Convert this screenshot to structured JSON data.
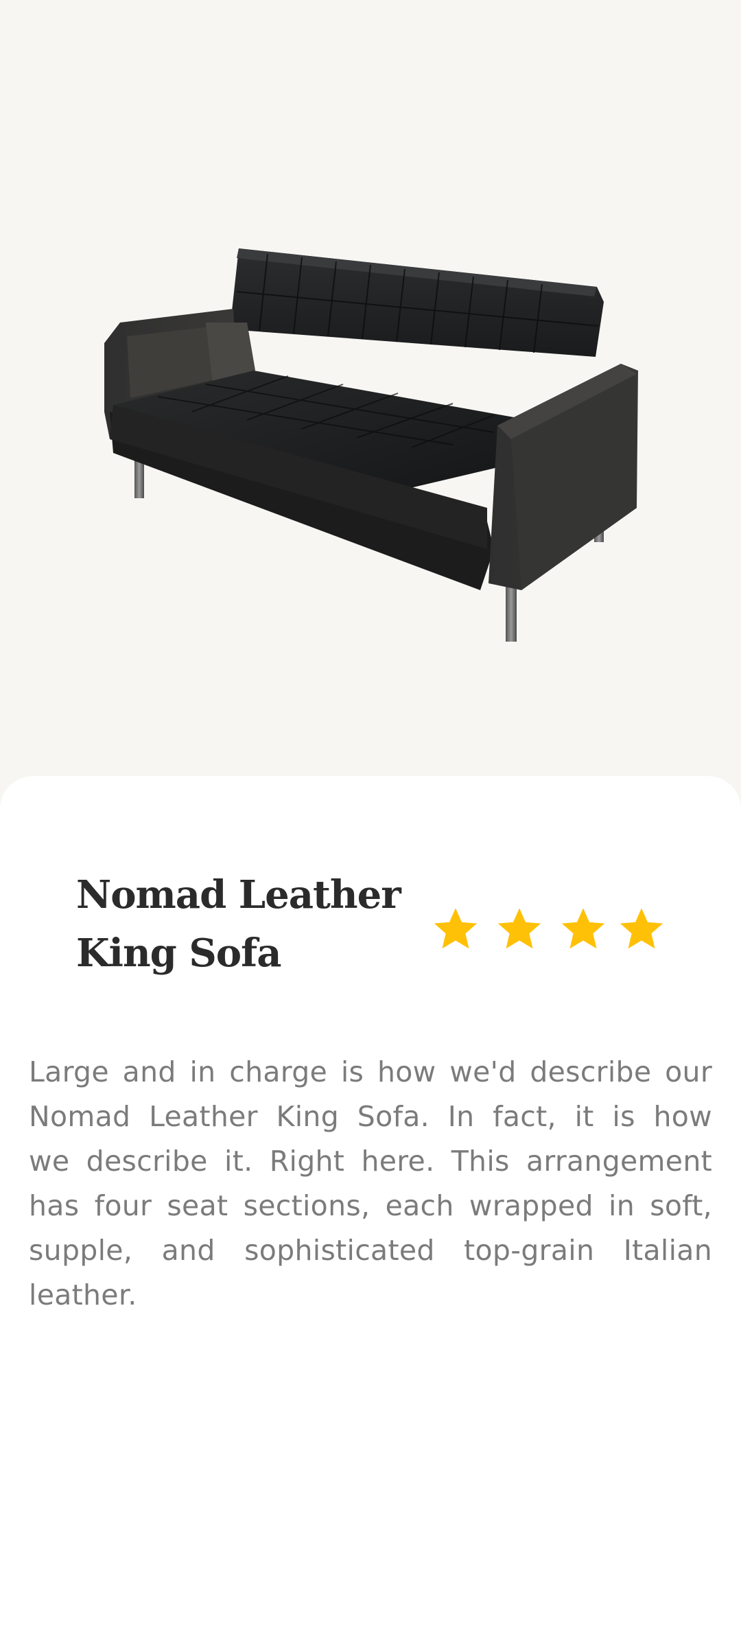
{
  "product": {
    "image_icon": "sofa-image",
    "title_line1": "Nomad Leather",
    "title_line2": "King Sofa",
    "rating": 4,
    "rating_max": 4,
    "star_color": "#ffc107",
    "description": "Large and in charge is how we'd describe our Nomad Leather King Sofa. In fact, it is how we describe it. Right here. This arrangement has four seat sections, each wrapped in soft, supple, and sophisticated top-grain Italian leather."
  },
  "colors": {
    "hero_background": "#f7f6f3",
    "sheet_background": "#ffffff",
    "title": "#2b2b2b",
    "description": "#7b7b7b"
  }
}
